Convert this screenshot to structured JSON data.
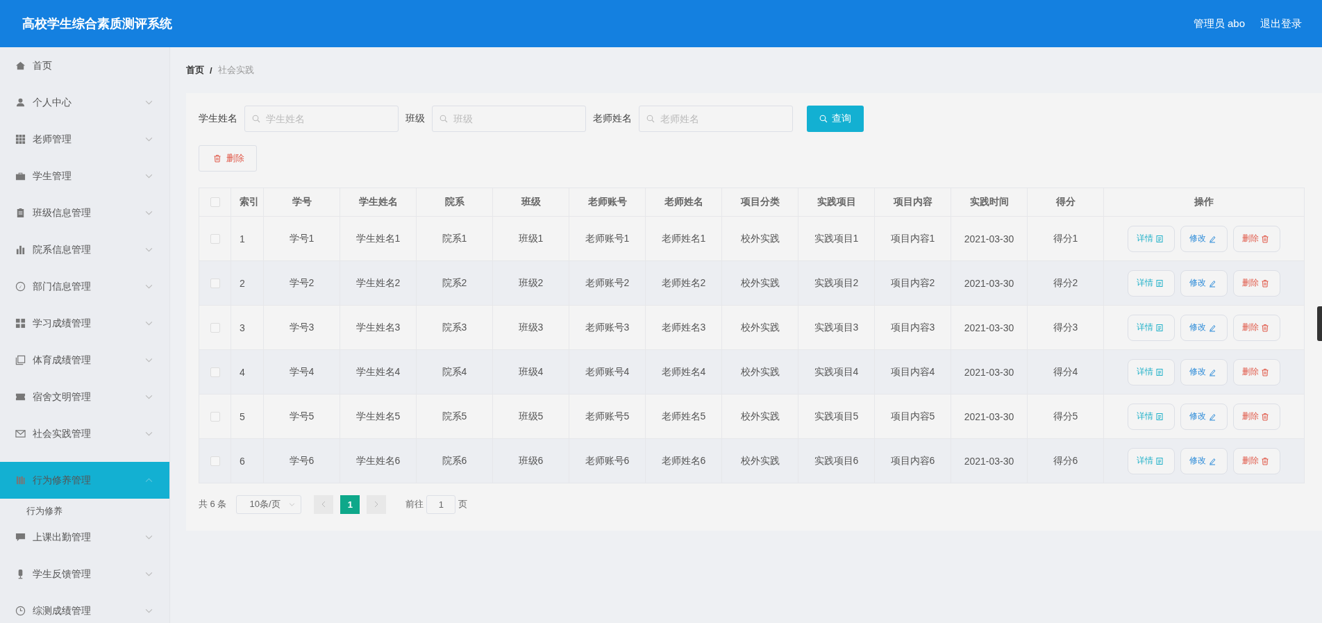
{
  "header": {
    "title": "高校学生综合素质测评系统",
    "user": "管理员 abo",
    "logout": "退出登录"
  },
  "sidebar": {
    "items": [
      {
        "label": "首页",
        "has_arrow": false,
        "expanded": false,
        "selected": false
      },
      {
        "label": "个人中心",
        "has_arrow": true,
        "expanded": false,
        "selected": false
      },
      {
        "label": "老师管理",
        "has_arrow": true,
        "expanded": false,
        "selected": false
      },
      {
        "label": "学生管理",
        "has_arrow": true,
        "expanded": false,
        "selected": false
      },
      {
        "label": "班级信息管理",
        "has_arrow": true,
        "expanded": false,
        "selected": false
      },
      {
        "label": "院系信息管理",
        "has_arrow": true,
        "expanded": false,
        "selected": false
      },
      {
        "label": "部门信息管理",
        "has_arrow": true,
        "expanded": false,
        "selected": false
      },
      {
        "label": "学习成绩管理",
        "has_arrow": true,
        "expanded": false,
        "selected": false
      },
      {
        "label": "体育成绩管理",
        "has_arrow": true,
        "expanded": false,
        "selected": false
      },
      {
        "label": "宿舍文明管理",
        "has_arrow": true,
        "expanded": false,
        "selected": false
      },
      {
        "label": "社会实践管理",
        "has_arrow": true,
        "expanded": false,
        "selected": false
      },
      {
        "label": "行为修养管理",
        "has_arrow": true,
        "expanded": true,
        "selected": true,
        "children": [
          {
            "label": "行为修养"
          }
        ]
      },
      {
        "label": "上课出勤管理",
        "has_arrow": true,
        "expanded": false,
        "selected": false
      },
      {
        "label": "学生反馈管理",
        "has_arrow": true,
        "expanded": false,
        "selected": false
      },
      {
        "label": "综测成绩管理",
        "has_arrow": true,
        "expanded": false,
        "selected": false
      }
    ]
  },
  "breadcrumb": {
    "home": "首页",
    "separator": "/",
    "current": "社会实践"
  },
  "search": {
    "fields": [
      {
        "label": "学生姓名",
        "placeholder": "学生姓名"
      },
      {
        "label": "班级",
        "placeholder": "班级"
      },
      {
        "label": "老师姓名",
        "placeholder": "老师姓名"
      }
    ],
    "button": "查询"
  },
  "delete_button": "删除",
  "table": {
    "all_checked": false,
    "columns": [
      "索引",
      "学号",
      "学生姓名",
      "院系",
      "班级",
      "老师账号",
      "老师姓名",
      "项目分类",
      "实践项目",
      "项目内容",
      "实践时间",
      "得分",
      "操作"
    ],
    "rows": [
      {
        "checked": false,
        "cells": [
          "1",
          "学号1",
          "学生姓名1",
          "院系1",
          "班级1",
          "老师账号1",
          "老师姓名1",
          "校外实践",
          "实践项目1",
          "项目内容1",
          "2021-03-30",
          "得分1"
        ],
        "actions": [
          "详情",
          "修改",
          "删除"
        ]
      },
      {
        "checked": false,
        "cells": [
          "2",
          "学号2",
          "学生姓名2",
          "院系2",
          "班级2",
          "老师账号2",
          "老师姓名2",
          "校外实践",
          "实践项目2",
          "项目内容2",
          "2021-03-30",
          "得分2"
        ],
        "actions": [
          "详情",
          "修改",
          "删除"
        ]
      },
      {
        "checked": false,
        "cells": [
          "3",
          "学号3",
          "学生姓名3",
          "院系3",
          "班级3",
          "老师账号3",
          "老师姓名3",
          "校外实践",
          "实践项目3",
          "项目内容3",
          "2021-03-30",
          "得分3"
        ],
        "actions": [
          "详情",
          "修改",
          "删除"
        ]
      },
      {
        "checked": false,
        "cells": [
          "4",
          "学号4",
          "学生姓名4",
          "院系4",
          "班级4",
          "老师账号4",
          "老师姓名4",
          "校外实践",
          "实践项目4",
          "项目内容4",
          "2021-03-30",
          "得分4"
        ],
        "actions": [
          "详情",
          "修改",
          "删除"
        ]
      },
      {
        "checked": false,
        "cells": [
          "5",
          "学号5",
          "学生姓名5",
          "院系5",
          "班级5",
          "老师账号5",
          "老师姓名5",
          "校外实践",
          "实践项目5",
          "项目内容5",
          "2021-03-30",
          "得分5"
        ],
        "actions": [
          "详情",
          "修改",
          "删除"
        ]
      },
      {
        "checked": false,
        "cells": [
          "6",
          "学号6",
          "学生姓名6",
          "院系6",
          "班级6",
          "老师账号6",
          "老师姓名6",
          "校外实践",
          "实践项目6",
          "项目内容6",
          "2021-03-30",
          "得分6"
        ],
        "actions": [
          "详情",
          "修改",
          "删除"
        ]
      }
    ]
  },
  "pagination": {
    "total": "共 6 条",
    "page_size": "10条/页",
    "pages": [
      {
        "label": "1",
        "selected": true
      }
    ],
    "goto_label": "前往",
    "goto_value": "1",
    "goto_suffix": "页"
  }
}
